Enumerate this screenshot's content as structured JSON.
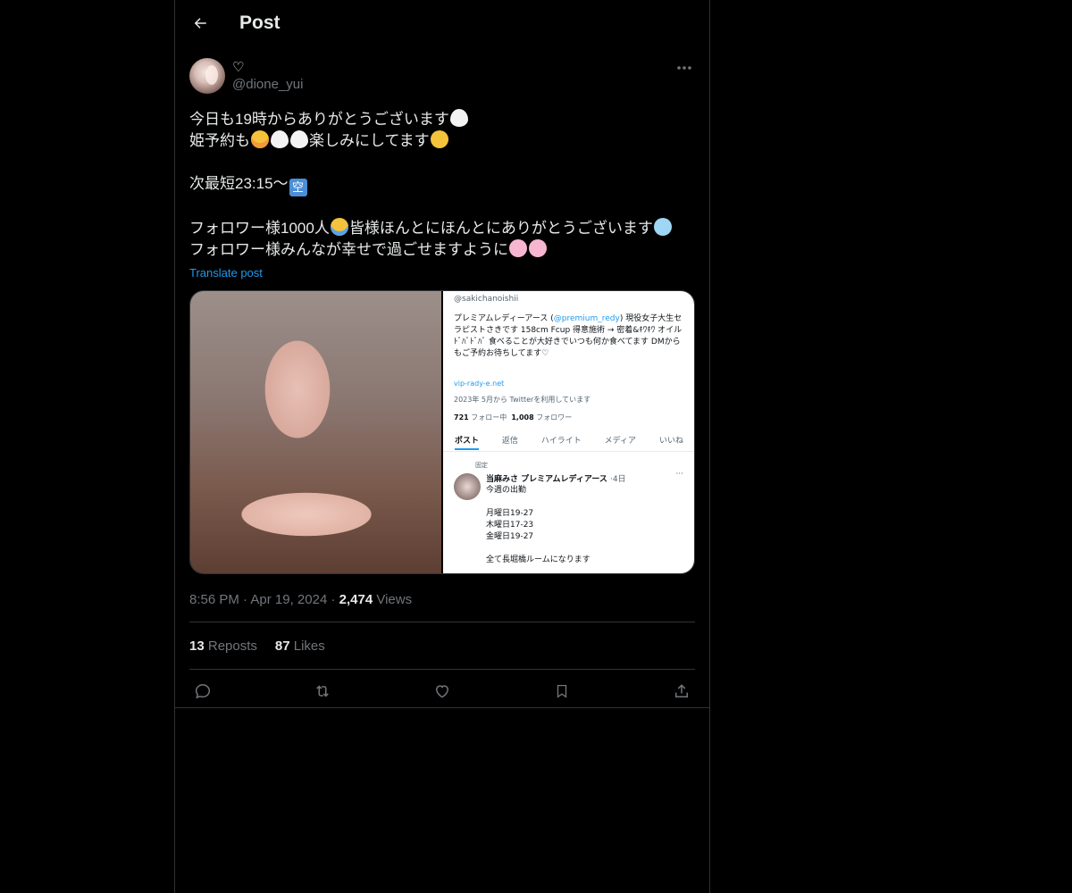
{
  "header": {
    "title": "Post"
  },
  "post": {
    "display_name": "♡",
    "handle": "@dione_yui",
    "lines": {
      "l1": "今日も19時からありがとうございます",
      "l2a": "姫予約も",
      "l2b": "楽しみにしてます",
      "l3": "次最短23:15〜",
      "l3_emoji": "空",
      "l4a": "フォロワー様1000人",
      "l4b": "皆様ほんとにほんとにありがとうございます",
      "l5": "フォロワー様みんなが幸せで過ごせますように"
    },
    "translate_label": "Translate post",
    "time": "8:56 PM",
    "date": "Apr 19, 2024",
    "views_count": "2,474",
    "views_label": "Views",
    "reposts_count": "13",
    "reposts_label": "Reposts",
    "likes_count": "87",
    "likes_label": "Likes"
  },
  "embedded_screenshot": {
    "handle": "@sakichanoishii",
    "bio_a": "プレミアムレディーアース",
    "bio_link": "@premium_redy",
    "bio_b": "現役女子大生セラピストさきです 158cm Fcup 得意施術 → 密着&ｷﾜｷﾜ オイルﾄﾞﾊﾞﾄﾞﾊﾞ 食べることが大好きでいつも何か食べてます DMからもご予約お待ちしてます♡",
    "url": "vip-rady-e.net",
    "joined": "2023年 5月から Twitterを利用しています",
    "following_count": "721",
    "following_label": "フォロー中",
    "followers_count": "1,008",
    "followers_label": "フォロワー",
    "tabs": [
      "ポスト",
      "返信",
      "ハイライト",
      "メディア",
      "いいね"
    ],
    "pinned": "固定",
    "tweet_name": "当麻みさ プレミアムレディアース",
    "tweet_age": "·4日",
    "tweet_body": "今週の出勤\n\n月曜日19-27\n木曜日17-23\n金曜日19-27\n\n全て長堀橋ルームになります"
  },
  "icons": [
    "back-arrow-icon",
    "more-icon",
    "reply-icon",
    "repost-icon",
    "like-icon",
    "bookmark-icon",
    "share-icon"
  ]
}
